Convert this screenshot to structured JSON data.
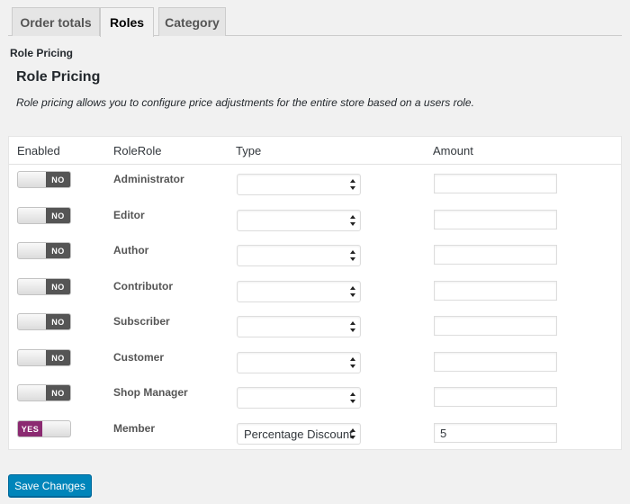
{
  "tabs": [
    {
      "label": "Order totals",
      "active": false
    },
    {
      "label": "Roles",
      "active": true
    },
    {
      "label": "Category",
      "active": false
    }
  ],
  "breadcrumb": "Role Pricing",
  "title": "Role Pricing",
  "description": "Role pricing allows you to configure price adjustments for the entire store based on a users role.",
  "table": {
    "headers": {
      "enabled": "Enabled",
      "role": "RoleRole",
      "type": "Type",
      "amount": "Amount"
    },
    "rows": [
      {
        "enabled": false,
        "toggle_label": "NO",
        "role": "Administrator",
        "type": "",
        "amount": ""
      },
      {
        "enabled": false,
        "toggle_label": "NO",
        "role": "Editor",
        "type": "",
        "amount": ""
      },
      {
        "enabled": false,
        "toggle_label": "NO",
        "role": "Author",
        "type": "",
        "amount": ""
      },
      {
        "enabled": false,
        "toggle_label": "NO",
        "role": "Contributor",
        "type": "",
        "amount": ""
      },
      {
        "enabled": false,
        "toggle_label": "NO",
        "role": "Subscriber",
        "type": "",
        "amount": ""
      },
      {
        "enabled": false,
        "toggle_label": "NO",
        "role": "Customer",
        "type": "",
        "amount": ""
      },
      {
        "enabled": false,
        "toggle_label": "NO",
        "role": "Shop Manager",
        "type": "",
        "amount": ""
      },
      {
        "enabled": true,
        "toggle_label": "YES",
        "role": "Member",
        "type": "Percentage Discount",
        "amount": "5"
      }
    ]
  },
  "save_label": "Save Changes",
  "colors": {
    "toggle_on": "#8b2a71",
    "toggle_off": "#555555",
    "primary_button": "#0085ba"
  }
}
